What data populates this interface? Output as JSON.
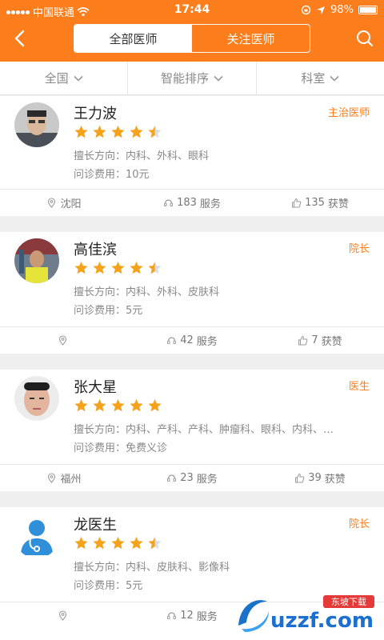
{
  "status": {
    "carrier": "中国联通",
    "time": "17:44",
    "battery": "98%",
    "battery_level": 0.98
  },
  "header": {
    "tabs": [
      "全部医师",
      "关注医师"
    ],
    "active_tab": 0
  },
  "filters": [
    "全国",
    "智能排序",
    "科室"
  ],
  "labels": {
    "specialty": "擅长方向：",
    "fee": "问诊费用：",
    "service_suffix": "服务",
    "likes_suffix": "获赞"
  },
  "doctors": [
    {
      "name": "王力波",
      "title": "主治医师",
      "rating": 4.5,
      "specialty": "内科、外科、眼科",
      "fee": "10元",
      "city": "沈阳",
      "services": "183",
      "likes": "135"
    },
    {
      "name": "高佳滨",
      "title": "院长",
      "rating": 4.5,
      "specialty": "内科、外科、皮肤科",
      "fee": "5元",
      "city": "",
      "services": "42",
      "likes": "7"
    },
    {
      "name": "张大星",
      "title": "医生",
      "rating": 5,
      "specialty": "内科、产科、产科、肿瘤科、眼科、内科、…",
      "fee": "免费义诊",
      "city": "福州",
      "services": "23",
      "likes": "39"
    },
    {
      "name": "龙医生",
      "title": "院长",
      "rating": 4.5,
      "specialty": "内科、皮肤科、影像科",
      "fee": "5元",
      "city": "",
      "services": "12",
      "likes": ""
    }
  ],
  "watermark": {
    "text": "uzzf.com",
    "tag": "东坡下载"
  },
  "colors": {
    "accent": "#fb7d1c",
    "star": "#f5a21b"
  },
  "icons": [
    "back-icon",
    "search-icon",
    "chevron-down-icon",
    "location-icon",
    "service-icon",
    "like-icon",
    "star-icon"
  ]
}
